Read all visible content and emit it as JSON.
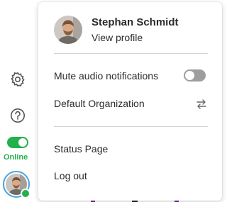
{
  "rail": {
    "settings_icon": "gear-icon",
    "help_icon": "question-circle-icon",
    "status_toggle_on": true,
    "status_label": "Online",
    "status_color": "#22b14c"
  },
  "profile": {
    "name": "Stephan Schmidt",
    "link": "View profile"
  },
  "menu": {
    "mute_label": "Mute audio notifications",
    "mute_enabled": false,
    "org_label": "Default Organization",
    "org_icon": "switch-arrows-icon",
    "status_page_label": "Status Page",
    "logout_label": "Log out"
  },
  "colors": {
    "accent_green": "#22b14c",
    "avatar_ring": "#4aa3df",
    "toggle_off": "#9e9e9e"
  }
}
